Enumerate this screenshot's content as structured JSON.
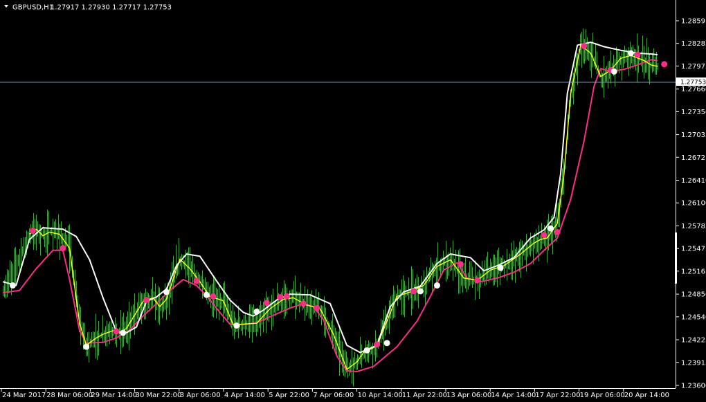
{
  "header": {
    "symbol": "GBPUSD,H1",
    "ohlc": "1.27917 1.27930 1.27717 1.27753"
  },
  "colors": {
    "background": "#000000",
    "bars": "#3ea83e",
    "white_line": "#ffffff",
    "magenta_line": "#ff2b8a",
    "yellow_line": "#ffff00",
    "axis": "#ffffff",
    "current_price_line": "#8fa8c0"
  },
  "chart_data": {
    "type": "line",
    "symbol": "GBPUSD",
    "timeframe": "H1",
    "y_ticks": [
      "1.28595",
      "1.28285",
      "1.27975",
      "1.27660",
      "1.27350",
      "1.27035",
      "1.26725",
      "1.26410",
      "1.26100",
      "1.25785",
      "1.25475",
      "1.25165",
      "1.24850",
      "1.24540",
      "1.24225",
      "1.23915",
      "1.23600"
    ],
    "ylim": [
      1.2359,
      1.2882
    ],
    "current_price": "1.27753",
    "x_ticks": [
      "24 Mar 2017",
      "28 Mar 06:00",
      "29 Mar 14:00",
      "30 Mar 22:00",
      "3 Apr 06:00",
      "4 Apr 14:00",
      "5 Apr 22:00",
      "7 Apr 06:00",
      "10 Apr 14:00",
      "11 Apr 22:00",
      "13 Apr 06:00",
      "14 Apr 14:00",
      "17 Apr 22:00",
      "19 Apr 06:00",
      "20 Apr 14:00"
    ],
    "x_range": [
      0,
      196
    ],
    "white_line": [
      [
        0,
        1.2502
      ],
      [
        4,
        1.2497
      ],
      [
        8,
        1.256
      ],
      [
        12,
        1.2576
      ],
      [
        18,
        1.2574
      ],
      [
        22,
        1.2564
      ],
      [
        26,
        1.2532
      ],
      [
        30,
        1.248
      ],
      [
        34,
        1.2434
      ],
      [
        37,
        1.2432
      ],
      [
        40,
        1.244
      ],
      [
        43,
        1.2475
      ],
      [
        46,
        1.2481
      ],
      [
        49,
        1.2492
      ],
      [
        52,
        1.2524
      ],
      [
        55,
        1.254
      ],
      [
        59,
        1.2537
      ],
      [
        64,
        1.2503
      ],
      [
        68,
        1.2477
      ],
      [
        72,
        1.246
      ],
      [
        75,
        1.2455
      ],
      [
        78,
        1.2463
      ],
      [
        82,
        1.2477
      ],
      [
        86,
        1.2485
      ],
      [
        92,
        1.2484
      ],
      [
        98,
        1.2472
      ],
      [
        103,
        1.2415
      ],
      [
        107,
        1.2405
      ],
      [
        112,
        1.2415
      ],
      [
        116,
        1.2468
      ],
      [
        120,
        1.2488
      ],
      [
        125,
        1.2496
      ],
      [
        130,
        1.2527
      ],
      [
        134,
        1.254
      ],
      [
        140,
        1.2535
      ],
      [
        144,
        1.2517
      ],
      [
        148,
        1.2524
      ],
      [
        153,
        1.2535
      ],
      [
        158,
        1.2562
      ],
      [
        162,
        1.2573
      ],
      [
        165,
        1.259
      ],
      [
        167,
        1.265
      ],
      [
        169,
        1.276
      ],
      [
        172,
        1.2826
      ],
      [
        176,
        1.283
      ],
      [
        180,
        1.2824
      ],
      [
        185,
        1.2819
      ],
      [
        190,
        1.2815
      ],
      [
        194,
        1.2814
      ],
      [
        196,
        1.2813
      ]
    ],
    "magenta_line": [
      [
        0,
        1.2487
      ],
      [
        5,
        1.249
      ],
      [
        10,
        1.252
      ],
      [
        15,
        1.2545
      ],
      [
        18,
        1.2545
      ],
      [
        20,
        1.2505
      ],
      [
        23,
        1.2435
      ],
      [
        25,
        1.2418
      ],
      [
        30,
        1.2419
      ],
      [
        34,
        1.2425
      ],
      [
        38,
        1.2436
      ],
      [
        42,
        1.2455
      ],
      [
        46,
        1.2472
      ],
      [
        50,
        1.249
      ],
      [
        54,
        1.2505
      ],
      [
        58,
        1.2497
      ],
      [
        61,
        1.2483
      ],
      [
        65,
        1.246
      ],
      [
        68,
        1.2444
      ],
      [
        72,
        1.2443
      ],
      [
        76,
        1.2446
      ],
      [
        82,
        1.2458
      ],
      [
        86,
        1.2466
      ],
      [
        90,
        1.2472
      ],
      [
        93,
        1.2468
      ],
      [
        96,
        1.245
      ],
      [
        100,
        1.24
      ],
      [
        103,
        1.238
      ],
      [
        106,
        1.2379
      ],
      [
        111,
        1.2386
      ],
      [
        118,
        1.2413
      ],
      [
        124,
        1.2448
      ],
      [
        128,
        1.2482
      ],
      [
        132,
        1.2518
      ],
      [
        136,
        1.2528
      ],
      [
        139,
        1.2507
      ],
      [
        143,
        1.2502
      ],
      [
        148,
        1.2507
      ],
      [
        153,
        1.2515
      ],
      [
        158,
        1.2527
      ],
      [
        162,
        1.2545
      ],
      [
        166,
        1.2562
      ],
      [
        170,
        1.2615
      ],
      [
        174,
        1.2695
      ],
      [
        177,
        1.277
      ],
      [
        179,
        1.2794
      ],
      [
        182,
        1.279
      ],
      [
        186,
        1.2793
      ],
      [
        190,
        1.2799
      ],
      [
        194,
        1.2806
      ],
      [
        196,
        1.2805
      ]
    ],
    "yellow_line": [
      [
        8,
        1.2567
      ],
      [
        10,
        1.2574
      ],
      [
        12,
        1.2565
      ],
      [
        14,
        1.257
      ],
      [
        17,
        1.2567
      ],
      [
        20,
        1.2548
      ],
      [
        23,
        1.2445
      ],
      [
        25,
        1.2415
      ],
      [
        28,
        1.2425
      ],
      [
        30,
        1.243
      ],
      [
        33,
        1.2435
      ],
      [
        35,
        1.2432
      ],
      [
        37,
        1.2438
      ],
      [
        42,
        1.2475
      ],
      [
        45,
        1.248
      ],
      [
        47,
        1.2468
      ],
      [
        49,
        1.2478
      ],
      [
        53,
        1.2533
      ],
      [
        56,
        1.252
      ],
      [
        59,
        1.2502
      ],
      [
        62,
        1.2482
      ],
      [
        66,
        1.2476
      ],
      [
        69,
        1.2443
      ],
      [
        72,
        1.2444
      ],
      [
        76,
        1.2445
      ],
      [
        80,
        1.2465
      ],
      [
        84,
        1.2478
      ],
      [
        87,
        1.248
      ],
      [
        91,
        1.247
      ],
      [
        95,
        1.2465
      ],
      [
        99,
        1.243
      ],
      [
        103,
        1.2382
      ],
      [
        106,
        1.2392
      ],
      [
        108,
        1.2405
      ],
      [
        112,
        1.2414
      ],
      [
        118,
        1.2482
      ],
      [
        122,
        1.2488
      ],
      [
        126,
        1.2497
      ],
      [
        130,
        1.2523
      ],
      [
        134,
        1.2532
      ],
      [
        138,
        1.2507
      ],
      [
        142,
        1.2504
      ],
      [
        146,
        1.2518
      ],
      [
        150,
        1.2524
      ],
      [
        155,
        1.254
      ],
      [
        159,
        1.2555
      ],
      [
        161,
        1.256
      ],
      [
        163,
        1.2562
      ],
      [
        166,
        1.2582
      ],
      [
        168,
        1.265
      ],
      [
        170,
        1.276
      ],
      [
        173,
        1.2826
      ],
      [
        176,
        1.2815
      ],
      [
        179,
        1.2783
      ],
      [
        182,
        1.2792
      ],
      [
        185,
        1.2808
      ],
      [
        188,
        1.2812
      ],
      [
        192,
        1.2805
      ],
      [
        194,
        1.2799
      ],
      [
        196,
        1.2797
      ]
    ],
    "magenta_dots": [
      [
        9,
        1.2572
      ],
      [
        18,
        1.2548
      ],
      [
        34,
        1.2434
      ],
      [
        43,
        1.2477
      ],
      [
        58,
        1.2503
      ],
      [
        63,
        1.2482
      ],
      [
        79,
        1.2473
      ],
      [
        83,
        1.2481
      ],
      [
        85,
        1.2482
      ],
      [
        90,
        1.2472
      ],
      [
        94,
        1.2466
      ],
      [
        112,
        1.2416
      ],
      [
        123,
        1.2489
      ],
      [
        137,
        1.2526
      ],
      [
        142,
        1.2504
      ],
      [
        162,
        1.2566
      ],
      [
        166,
        1.257
      ],
      [
        174,
        1.2825
      ],
      [
        182,
        1.2792
      ],
      [
        190,
        1.2813
      ],
      [
        198,
        1.28
      ]
    ],
    "white_dots": [
      [
        3,
        1.2497
      ],
      [
        25,
        1.2413
      ],
      [
        36,
        1.2432
      ],
      [
        49,
        1.2488
      ],
      [
        61,
        1.2484
      ],
      [
        70,
        1.2442
      ],
      [
        76,
        1.2461
      ],
      [
        109,
        1.2408
      ],
      [
        115,
        1.2418
      ],
      [
        125,
        1.2489
      ],
      [
        130,
        1.2497
      ],
      [
        149,
        1.2521
      ],
      [
        164,
        1.2575
      ],
      [
        183,
        1.279
      ],
      [
        188,
        1.2815
      ]
    ]
  }
}
